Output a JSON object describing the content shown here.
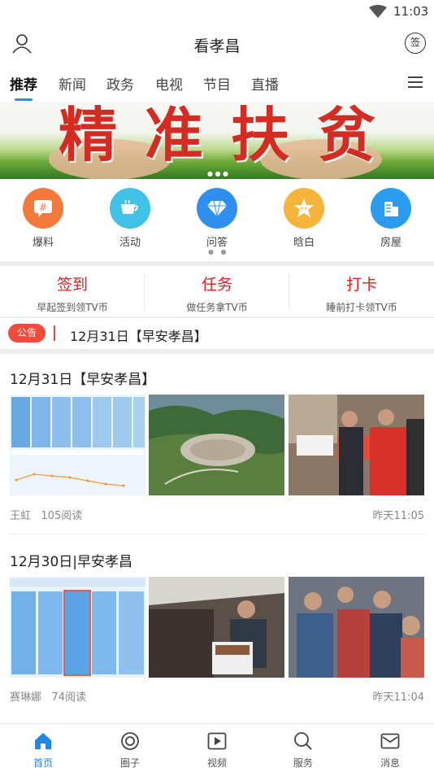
{
  "status_bar": {
    "time": "11:03"
  },
  "header": {
    "title": "看孝昌",
    "sign_label": "签"
  },
  "tabs": [
    {
      "label": "推荐",
      "active": true
    },
    {
      "label": "新闻"
    },
    {
      "label": "政务"
    },
    {
      "label": "电视"
    },
    {
      "label": "节目"
    },
    {
      "label": "直播"
    }
  ],
  "banner": {
    "slogan": "精准扶贫"
  },
  "quick_links": [
    {
      "label": "爆料",
      "icon": "hash-chat-icon",
      "color": "#f47a3c"
    },
    {
      "label": "活动",
      "icon": "coffee-cup-icon",
      "color": "#3fc1e8"
    },
    {
      "label": "问答",
      "icon": "diamond-icon",
      "color": "#2f8fee"
    },
    {
      "label": "晗白",
      "icon": "star-face-icon",
      "color": "#f6b43a"
    },
    {
      "label": "房屋",
      "icon": "building-icon",
      "color": "#2b9bf0"
    }
  ],
  "tasks": [
    {
      "title": "签到",
      "subtitle": "早起签到领TV币"
    },
    {
      "title": "任务",
      "subtitle": "做任务拿TV币"
    },
    {
      "title": "打卡",
      "subtitle": "睡前打卡领TV币"
    }
  ],
  "notice": {
    "badge": "公告",
    "text": "12月31日【早安孝昌】"
  },
  "articles": [
    {
      "title": "12月31日【早安孝昌】",
      "author": "王虹",
      "reads": "105阅读",
      "time": "昨天11:05"
    },
    {
      "title": "12月30日|早安孝昌",
      "author": "赛琳娜",
      "reads": "74阅读",
      "time": "昨天11:04"
    }
  ],
  "bottom_nav": [
    {
      "label": "首页",
      "icon": "home-icon",
      "active": true
    },
    {
      "label": "圈子",
      "icon": "circle-icon"
    },
    {
      "label": "视频",
      "icon": "play-icon"
    },
    {
      "label": "服务",
      "icon": "search-icon"
    },
    {
      "label": "消息",
      "icon": "mail-icon"
    }
  ],
  "colors": {
    "accent": "#1e90ff",
    "red": "#e02020",
    "notice_badge": "#ef4b3a"
  }
}
